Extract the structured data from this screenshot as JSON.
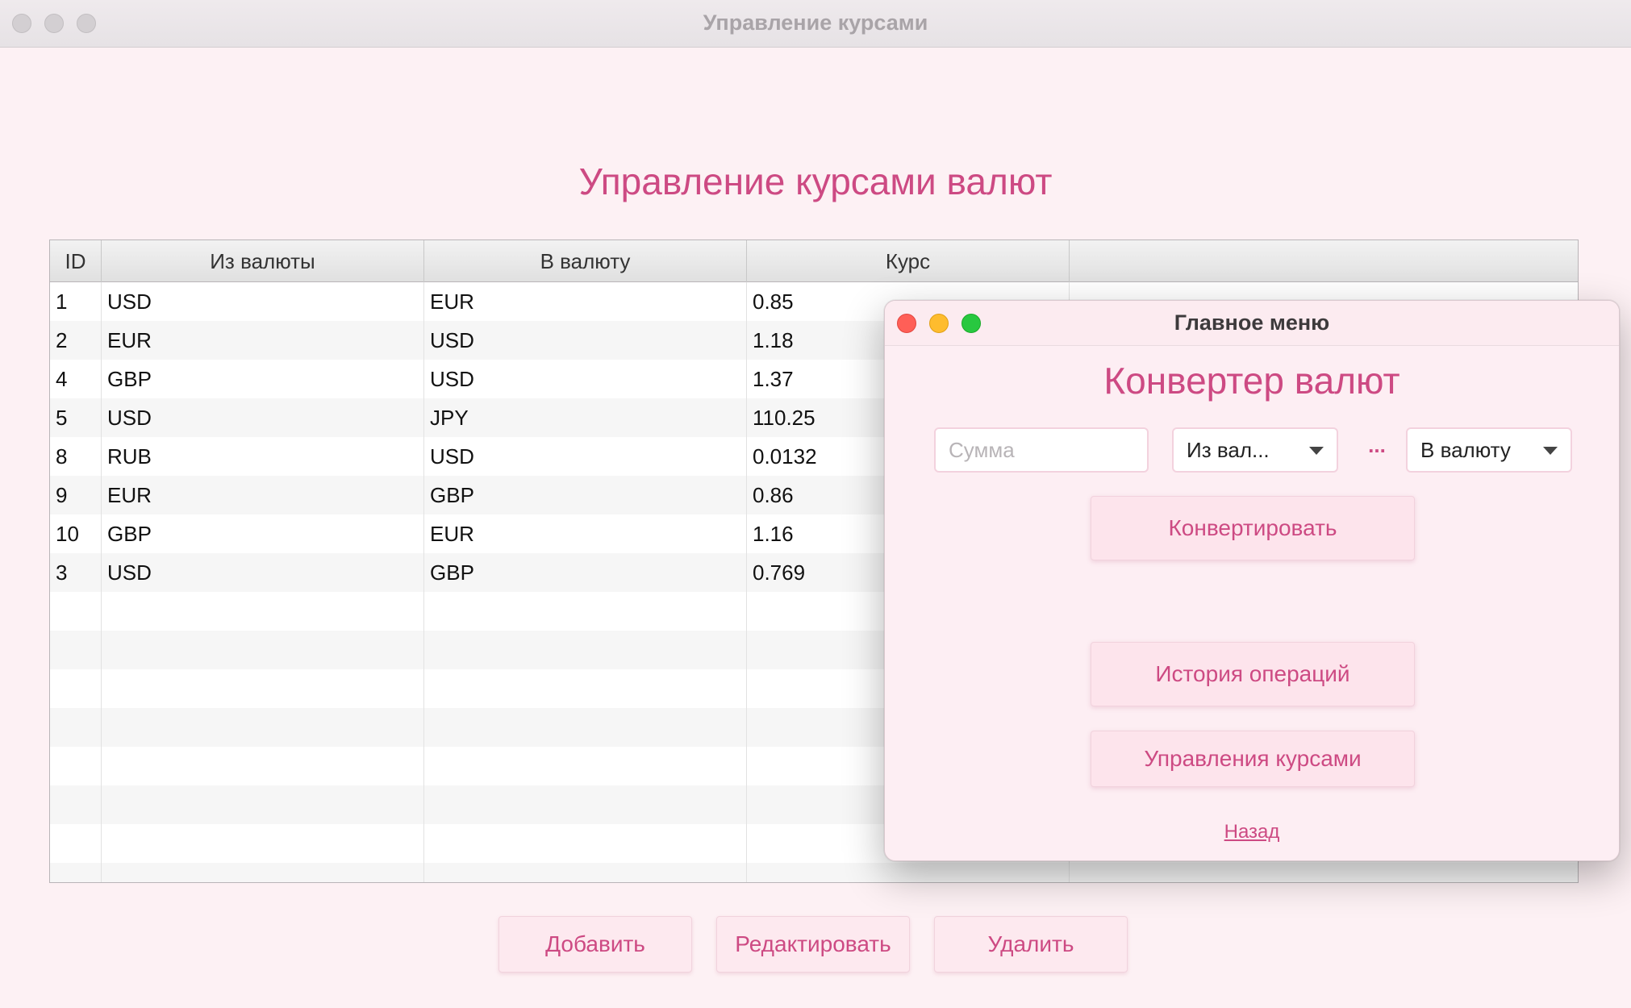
{
  "back_window": {
    "title": "Управление курсами",
    "heading": "Управление курсами валют",
    "table": {
      "columns": [
        "ID",
        "Из валюты",
        "В валюту",
        "Курс",
        ""
      ],
      "rows": [
        {
          "id": "1",
          "from": "USD",
          "to": "EUR",
          "rate": "0.85"
        },
        {
          "id": "2",
          "from": "EUR",
          "to": "USD",
          "rate": "1.18"
        },
        {
          "id": "4",
          "from": "GBP",
          "to": "USD",
          "rate": "1.37"
        },
        {
          "id": "5",
          "from": "USD",
          "to": "JPY",
          "rate": "110.25"
        },
        {
          "id": "8",
          "from": "RUB",
          "to": "USD",
          "rate": "0.0132"
        },
        {
          "id": "9",
          "from": "EUR",
          "to": "GBP",
          "rate": "0.86"
        },
        {
          "id": "10",
          "from": "GBP",
          "to": "EUR",
          "rate": "1.16"
        },
        {
          "id": "3",
          "from": "USD",
          "to": "GBP",
          "rate": "0.769"
        }
      ]
    },
    "buttons": {
      "add": "Добавить",
      "edit": "Редактировать",
      "delete": "Удалить"
    }
  },
  "front_window": {
    "title": "Главное меню",
    "heading": "Конвертер валют",
    "amount_placeholder": "Сумма",
    "from_select": "Из вал...",
    "swap_label": "...",
    "to_select": "В валюту",
    "convert_button": "Конвертировать",
    "history_button": "История операций",
    "manage_button": "Управления курсами",
    "back_link": "Назад"
  },
  "colors": {
    "accent": "#cd4a83",
    "window_bg": "#fdf1f4",
    "button_bg": "#fde9ef"
  }
}
